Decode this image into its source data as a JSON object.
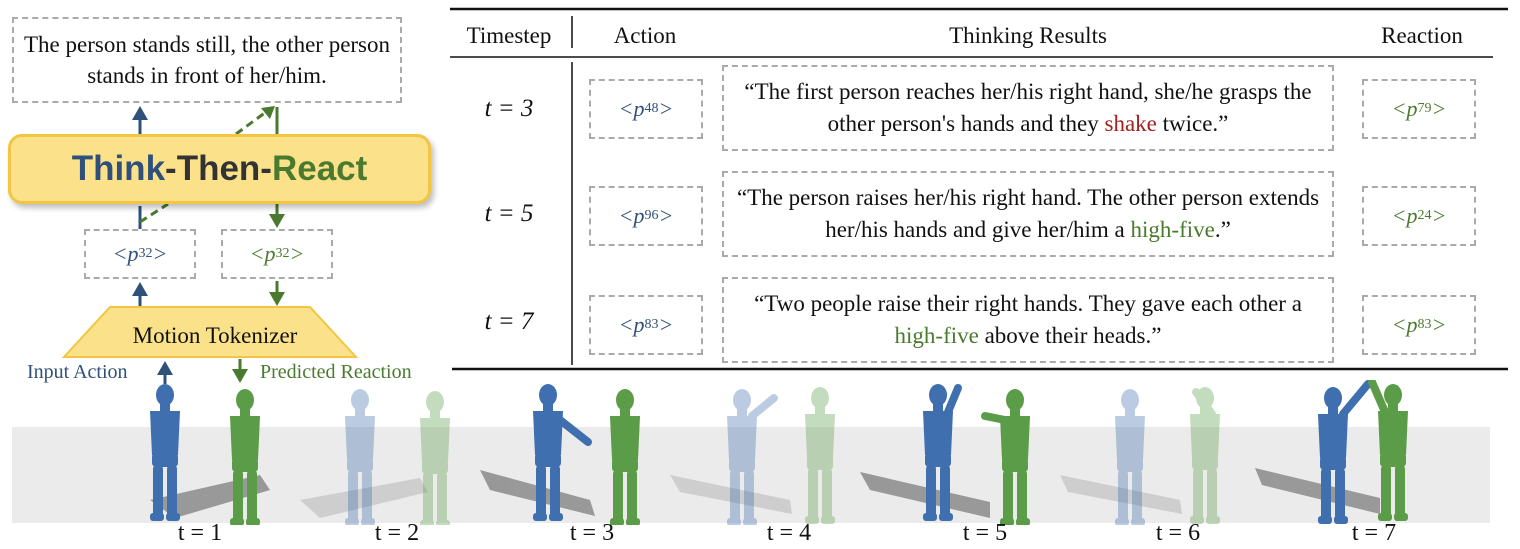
{
  "left_panel": {
    "caption": "The person stands still, the other person stands in front of her/him.",
    "ttr": {
      "think": "Think",
      "dash1": "-",
      "then": "Then",
      "dash2": "-",
      "react": "React"
    },
    "token_left": {
      "open": "<p",
      "sub": "32",
      "close": ">"
    },
    "token_right": {
      "open": "<p",
      "sub": "32",
      "close": ">"
    },
    "motion_tokenizer": "Motion Tokenizer",
    "input_label": "Input Action",
    "predicted_label": "Predicted Reaction"
  },
  "table": {
    "headers": {
      "timestep": "Timestep",
      "action": "Action",
      "thinking": "Thinking Results",
      "reaction": "Reaction"
    },
    "rows": [
      {
        "t": "t = 3",
        "action": {
          "open": "<p",
          "sub": "48",
          "close": ">"
        },
        "reaction": {
          "open": "<p",
          "sub": "79",
          "close": ">"
        },
        "text_before": "“The first person reaches her/his right hand, she/he grasps the other person's hands and they ",
        "highlight": "shake",
        "text_after": " twice.”"
      },
      {
        "t": "t = 5",
        "action": {
          "open": "<p",
          "sub": "96",
          "close": ">"
        },
        "reaction": {
          "open": "<p",
          "sub": "24",
          "close": ">"
        },
        "text_before": "“The person raises her/his right hand. The other person extends her/his hands and give her/him a ",
        "highlight": "high-five",
        "text_after": ".”"
      },
      {
        "t": "t = 7",
        "action": {
          "open": "<p",
          "sub": "83",
          "close": ">"
        },
        "reaction": {
          "open": "<p",
          "sub": "83",
          "close": ">"
        },
        "text_before": "“Two people raise their right hands. They gave each other a ",
        "highlight": "high-five",
        "text_after": " above their heads.”"
      }
    ]
  },
  "timeline": [
    "t = 1",
    "t = 2",
    "t = 3",
    "t = 4",
    "t = 5",
    "t = 6",
    "t = 7"
  ],
  "colors": {
    "action_blue": "#2f507a",
    "reaction_green": "#4a7a2d",
    "shake_red": "#a31f1f",
    "ttr_fill": "#fbe28a"
  }
}
